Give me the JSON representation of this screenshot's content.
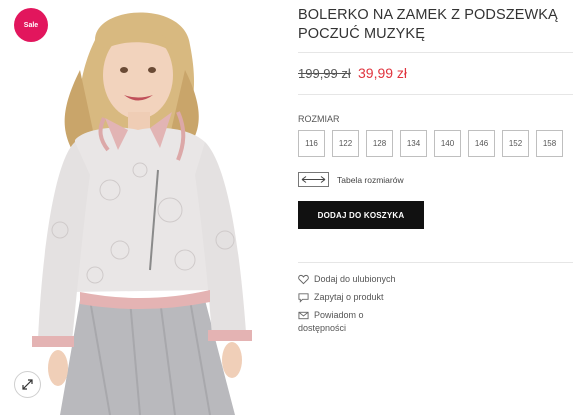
{
  "gallery": {
    "sale_badge": "Sale",
    "zoom_icon": "expand-arrows-icon"
  },
  "product": {
    "title": "BOLERKO NA ZAMEK Z PODSZEWKĄ POCZUĆ MUZYKĘ",
    "price_old": "199,99 zł",
    "price_new": "39,99 zł",
    "size_label": "ROZMIAR",
    "sizes": [
      "116",
      "122",
      "128",
      "134",
      "140",
      "146",
      "152",
      "158"
    ],
    "size_table_label": "Tabela rozmiarów",
    "add_to_cart_label": "DODAJ DO KOSZYKA"
  },
  "actions": {
    "wishlist": "Dodaj do ulubionych",
    "ask": "Zapytaj o produkt",
    "notify_line1": "Powiadom o",
    "notify_line2": "dostępności"
  },
  "colors": {
    "sale": "#e2165d",
    "price_new": "#e0343e",
    "button": "#111111"
  }
}
